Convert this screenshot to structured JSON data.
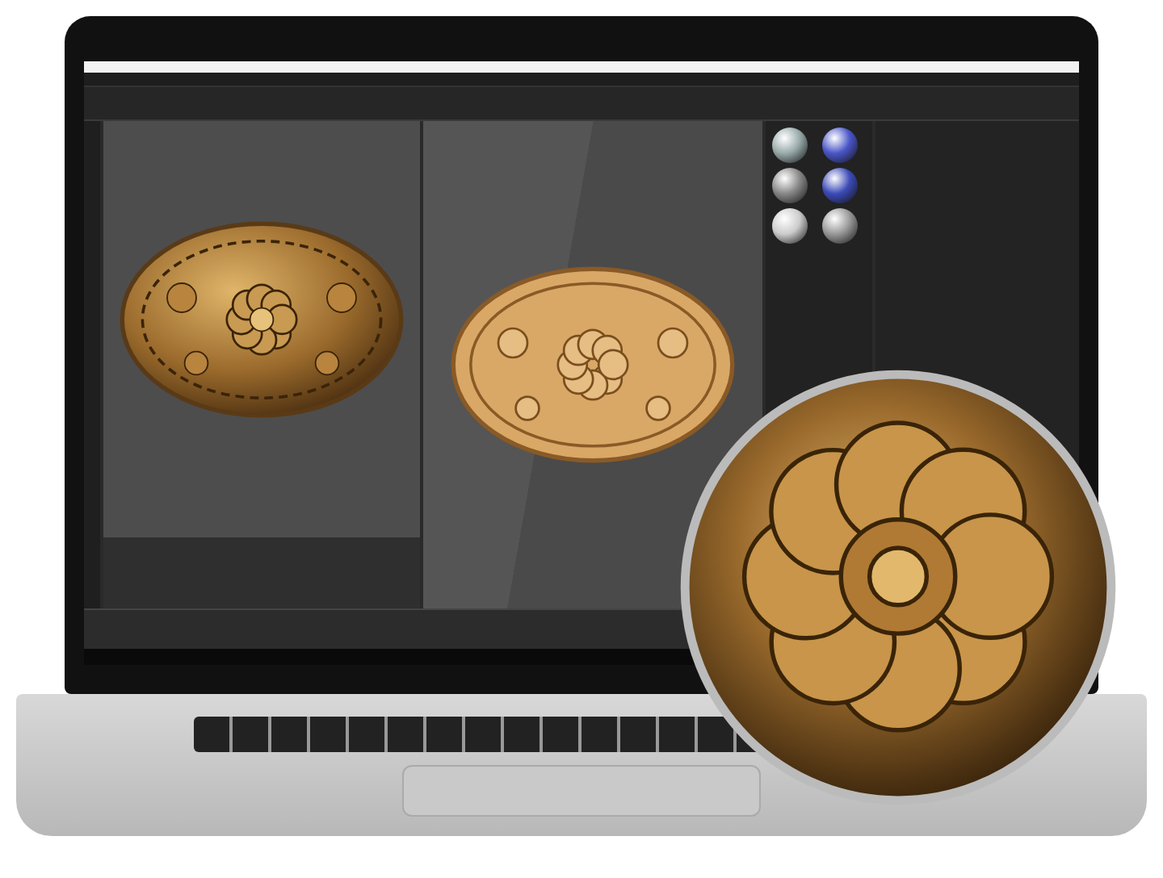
{
  "viewports": [
    {
      "kind": "render"
    },
    {
      "kind": "wireframe"
    }
  ]
}
